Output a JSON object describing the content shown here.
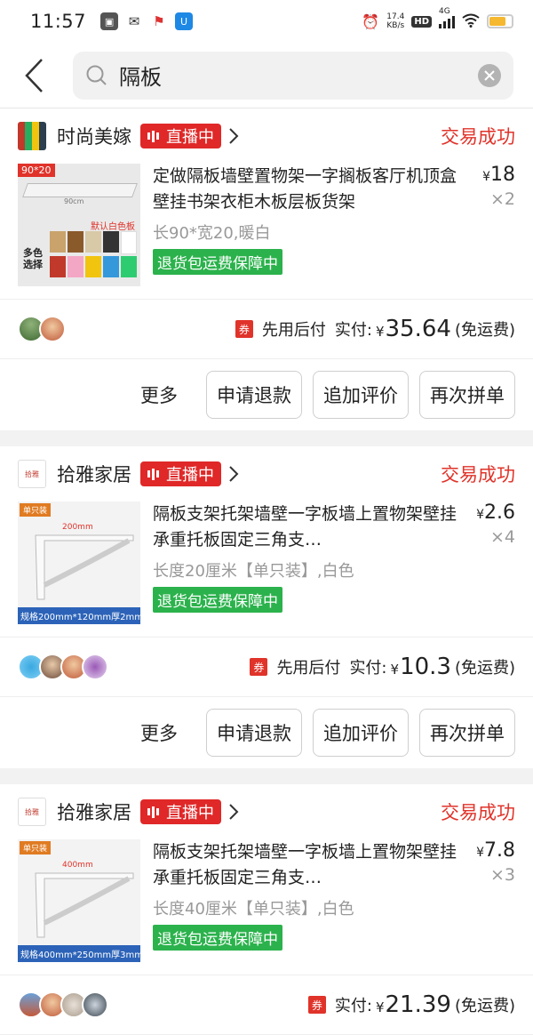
{
  "status_bar": {
    "time": "11:57",
    "net_speed_value": "17.4",
    "net_speed_unit": "KB/s",
    "hd": "HD",
    "network": "4G"
  },
  "search": {
    "query": "隔板"
  },
  "orders": [
    {
      "shop": "时尚美嫁",
      "live_label": "直播中",
      "status": "交易成功",
      "title": "定做隔板墙壁置物架一字搁板客厅机顶盒壁挂书架衣柜木板层板货架",
      "spec": "长90*宽20,暖白",
      "tag": "退货包运费保障中",
      "price": "18",
      "qty": "×2",
      "paylater": "先用后付",
      "actual_label": "实付:",
      "amount": "35.64",
      "shipping": "(免运费)",
      "thumb_text": {
        "top": "90*20",
        "size": "90cm",
        "default": "默认白色板",
        "multi": "多色\n选择"
      }
    },
    {
      "shop": "拾雅家居",
      "live_label": "直播中",
      "status": "交易成功",
      "title": "隔板支架托架墙壁一字板墙上置物架壁挂承重托板固定三角支…",
      "spec": "长度20厘米【单只装】,白色",
      "tag": "退货包运费保障中",
      "price": "2.6",
      "qty": "×4",
      "paylater": "先用后付",
      "actual_label": "实付:",
      "amount": "10.3",
      "shipping": "(免运费)",
      "thumb_text": {
        "badge": "单只装",
        "caption": "规格200mm*120mm厚2mm",
        "size": "200mm"
      }
    },
    {
      "shop": "拾雅家居",
      "live_label": "直播中",
      "status": "交易成功",
      "title": "隔板支架托架墙壁一字板墙上置物架壁挂承重托板固定三角支…",
      "spec": "长度40厘米【单只装】,白色",
      "tag": "退货包运费保障中",
      "price": "7.8",
      "qty": "×3",
      "paylater": "",
      "actual_label": "实付:",
      "amount": "21.39",
      "shipping": "(免运费)",
      "thumb_text": {
        "badge": "单只装",
        "caption": "规格400mm*250mm厚3mm",
        "size": "400mm"
      }
    }
  ],
  "actions": {
    "more": "更多",
    "refund": "申请退款",
    "review": "追加评价",
    "rebuy": "再次拼单"
  },
  "currency": "¥",
  "coupon_label": "券",
  "colors": {
    "accent_red": "#e0332a",
    "tag_green": "#2bb24c"
  }
}
